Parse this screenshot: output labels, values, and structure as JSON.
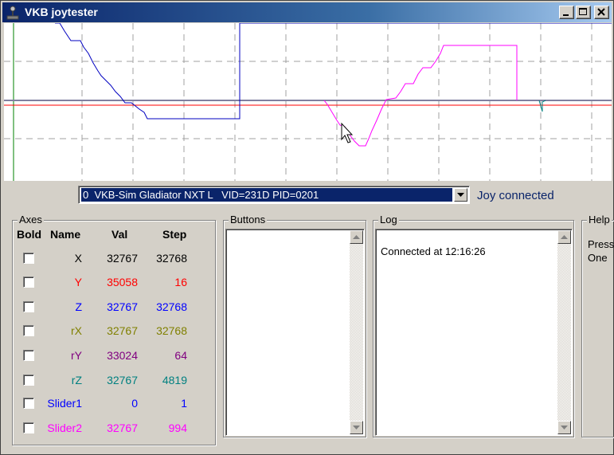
{
  "window": {
    "title": "VKB joytester"
  },
  "device": {
    "selected": "0  VKB-Sim Gladiator NXT L   VID=231D PID=0201",
    "status": "Joy connected"
  },
  "axes": {
    "group_label": "Axes",
    "headers": {
      "bold": "Bold",
      "name": "Name",
      "val": "Val",
      "step": "Step"
    },
    "rows": [
      {
        "name": "X",
        "val": "32767",
        "step": "32768",
        "color": "#000000"
      },
      {
        "name": "Y",
        "val": "35058",
        "step": "16",
        "color": "#ff0000"
      },
      {
        "name": "Z",
        "val": "32767",
        "step": "32768",
        "color": "#0000ff"
      },
      {
        "name": "rX",
        "val": "32767",
        "step": "32768",
        "color": "#808000"
      },
      {
        "name": "rY",
        "val": "33024",
        "step": "64",
        "color": "#800080"
      },
      {
        "name": "rZ",
        "val": "32767",
        "step": "4819",
        "color": "#008080"
      },
      {
        "name": "Slider1",
        "val": "0",
        "step": "1",
        "color": "#0000ff"
      },
      {
        "name": "Slider2",
        "val": "32767",
        "step": "994",
        "color": "#ff00ff"
      }
    ]
  },
  "buttons": {
    "group_label": "Buttons"
  },
  "log": {
    "group_label": "Log",
    "lines": [
      "Connected at 12:16:26"
    ]
  },
  "help": {
    "group_label": "Help",
    "lines": [
      "Press",
      "One"
    ]
  }
}
